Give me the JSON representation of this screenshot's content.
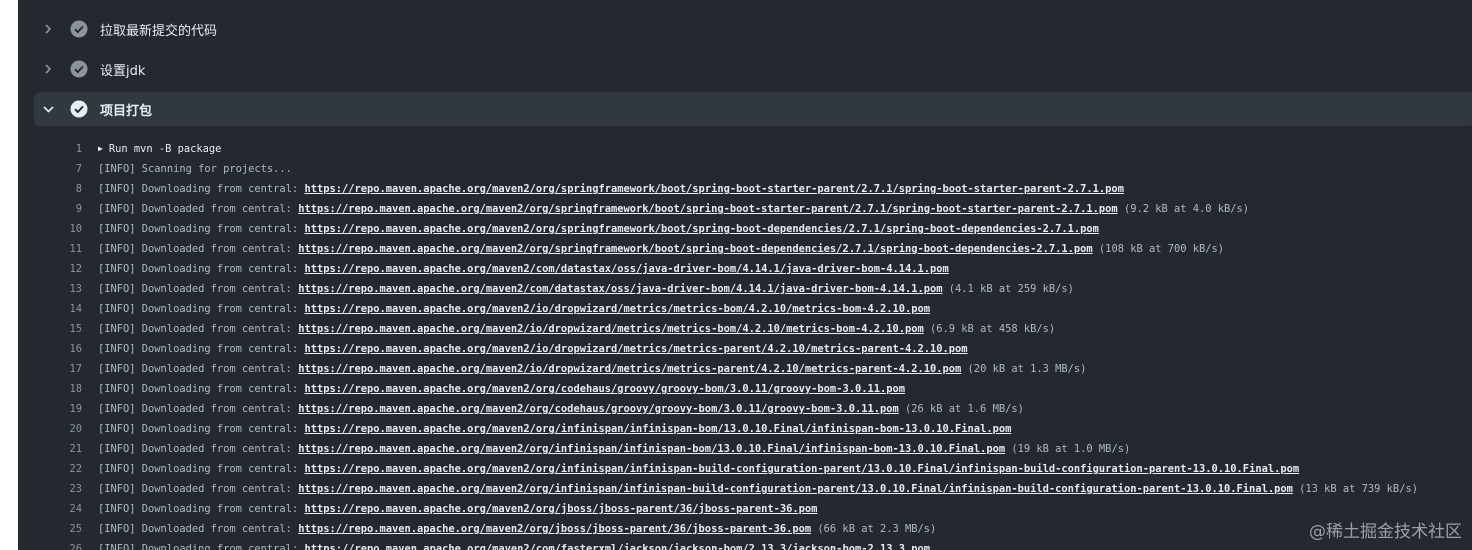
{
  "steps": [
    {
      "title": "拉取最新提交的代码",
      "expanded": false
    },
    {
      "title": "设置jdk",
      "expanded": false
    },
    {
      "title": "项目打包",
      "expanded": true
    }
  ],
  "log": [
    {
      "n": "1",
      "text": "Run mvn -B package",
      "cmd": true
    },
    {
      "n": "7",
      "text": "[INFO] Scanning for projects..."
    },
    {
      "n": "8",
      "text": "[INFO] Downloading from central: ",
      "url": "https://repo.maven.apache.org/maven2/org/springframework/boot/spring-boot-starter-parent/2.7.1/spring-boot-starter-parent-2.7.1.pom",
      "suffix": ""
    },
    {
      "n": "9",
      "text": "[INFO] Downloaded from central: ",
      "url": "https://repo.maven.apache.org/maven2/org/springframework/boot/spring-boot-starter-parent/2.7.1/spring-boot-starter-parent-2.7.1.pom",
      "suffix": " (9.2 kB at 4.0 kB/s)"
    },
    {
      "n": "10",
      "text": "[INFO] Downloading from central: ",
      "url": "https://repo.maven.apache.org/maven2/org/springframework/boot/spring-boot-dependencies/2.7.1/spring-boot-dependencies-2.7.1.pom",
      "suffix": ""
    },
    {
      "n": "11",
      "text": "[INFO] Downloaded from central: ",
      "url": "https://repo.maven.apache.org/maven2/org/springframework/boot/spring-boot-dependencies/2.7.1/spring-boot-dependencies-2.7.1.pom",
      "suffix": " (108 kB at 700 kB/s)"
    },
    {
      "n": "12",
      "text": "[INFO] Downloading from central: ",
      "url": "https://repo.maven.apache.org/maven2/com/datastax/oss/java-driver-bom/4.14.1/java-driver-bom-4.14.1.pom",
      "suffix": ""
    },
    {
      "n": "13",
      "text": "[INFO] Downloaded from central: ",
      "url": "https://repo.maven.apache.org/maven2/com/datastax/oss/java-driver-bom/4.14.1/java-driver-bom-4.14.1.pom",
      "suffix": " (4.1 kB at 259 kB/s)"
    },
    {
      "n": "14",
      "text": "[INFO] Downloading from central: ",
      "url": "https://repo.maven.apache.org/maven2/io/dropwizard/metrics/metrics-bom/4.2.10/metrics-bom-4.2.10.pom",
      "suffix": ""
    },
    {
      "n": "15",
      "text": "[INFO] Downloaded from central: ",
      "url": "https://repo.maven.apache.org/maven2/io/dropwizard/metrics/metrics-bom/4.2.10/metrics-bom-4.2.10.pom",
      "suffix": " (6.9 kB at 458 kB/s)"
    },
    {
      "n": "16",
      "text": "[INFO] Downloading from central: ",
      "url": "https://repo.maven.apache.org/maven2/io/dropwizard/metrics/metrics-parent/4.2.10/metrics-parent-4.2.10.pom",
      "suffix": ""
    },
    {
      "n": "17",
      "text": "[INFO] Downloaded from central: ",
      "url": "https://repo.maven.apache.org/maven2/io/dropwizard/metrics/metrics-parent/4.2.10/metrics-parent-4.2.10.pom",
      "suffix": " (20 kB at 1.3 MB/s)"
    },
    {
      "n": "18",
      "text": "[INFO] Downloading from central: ",
      "url": "https://repo.maven.apache.org/maven2/org/codehaus/groovy/groovy-bom/3.0.11/groovy-bom-3.0.11.pom",
      "suffix": ""
    },
    {
      "n": "19",
      "text": "[INFO] Downloaded from central: ",
      "url": "https://repo.maven.apache.org/maven2/org/codehaus/groovy/groovy-bom/3.0.11/groovy-bom-3.0.11.pom",
      "suffix": " (26 kB at 1.6 MB/s)"
    },
    {
      "n": "20",
      "text": "[INFO] Downloading from central: ",
      "url": "https://repo.maven.apache.org/maven2/org/infinispan/infinispan-bom/13.0.10.Final/infinispan-bom-13.0.10.Final.pom",
      "suffix": ""
    },
    {
      "n": "21",
      "text": "[INFO] Downloaded from central: ",
      "url": "https://repo.maven.apache.org/maven2/org/infinispan/infinispan-bom/13.0.10.Final/infinispan-bom-13.0.10.Final.pom",
      "suffix": " (19 kB at 1.0 MB/s)"
    },
    {
      "n": "22",
      "text": "[INFO] Downloading from central: ",
      "url": "https://repo.maven.apache.org/maven2/org/infinispan/infinispan-build-configuration-parent/13.0.10.Final/infinispan-build-configuration-parent-13.0.10.Final.pom",
      "suffix": ""
    },
    {
      "n": "23",
      "text": "[INFO] Downloaded from central: ",
      "url": "https://repo.maven.apache.org/maven2/org/infinispan/infinispan-build-configuration-parent/13.0.10.Final/infinispan-build-configuration-parent-13.0.10.Final.pom",
      "suffix": " (13 kB at 739 kB/s)"
    },
    {
      "n": "24",
      "text": "[INFO] Downloading from central: ",
      "url": "https://repo.maven.apache.org/maven2/org/jboss/jboss-parent/36/jboss-parent-36.pom",
      "suffix": ""
    },
    {
      "n": "25",
      "text": "[INFO] Downloaded from central: ",
      "url": "https://repo.maven.apache.org/maven2/org/jboss/jboss-parent/36/jboss-parent-36.pom",
      "suffix": " (66 kB at 2.3 MB/s)"
    },
    {
      "n": "26",
      "text": "[INFO] Downloading from central: ",
      "url": "https://repo.maven.apache.org/maven2/com/fasterxml/jackson/jackson-bom/2.13.3/jackson-bom-2.13.3.pom",
      "suffix": ""
    }
  ],
  "watermark": "@稀土掘金技术社区"
}
